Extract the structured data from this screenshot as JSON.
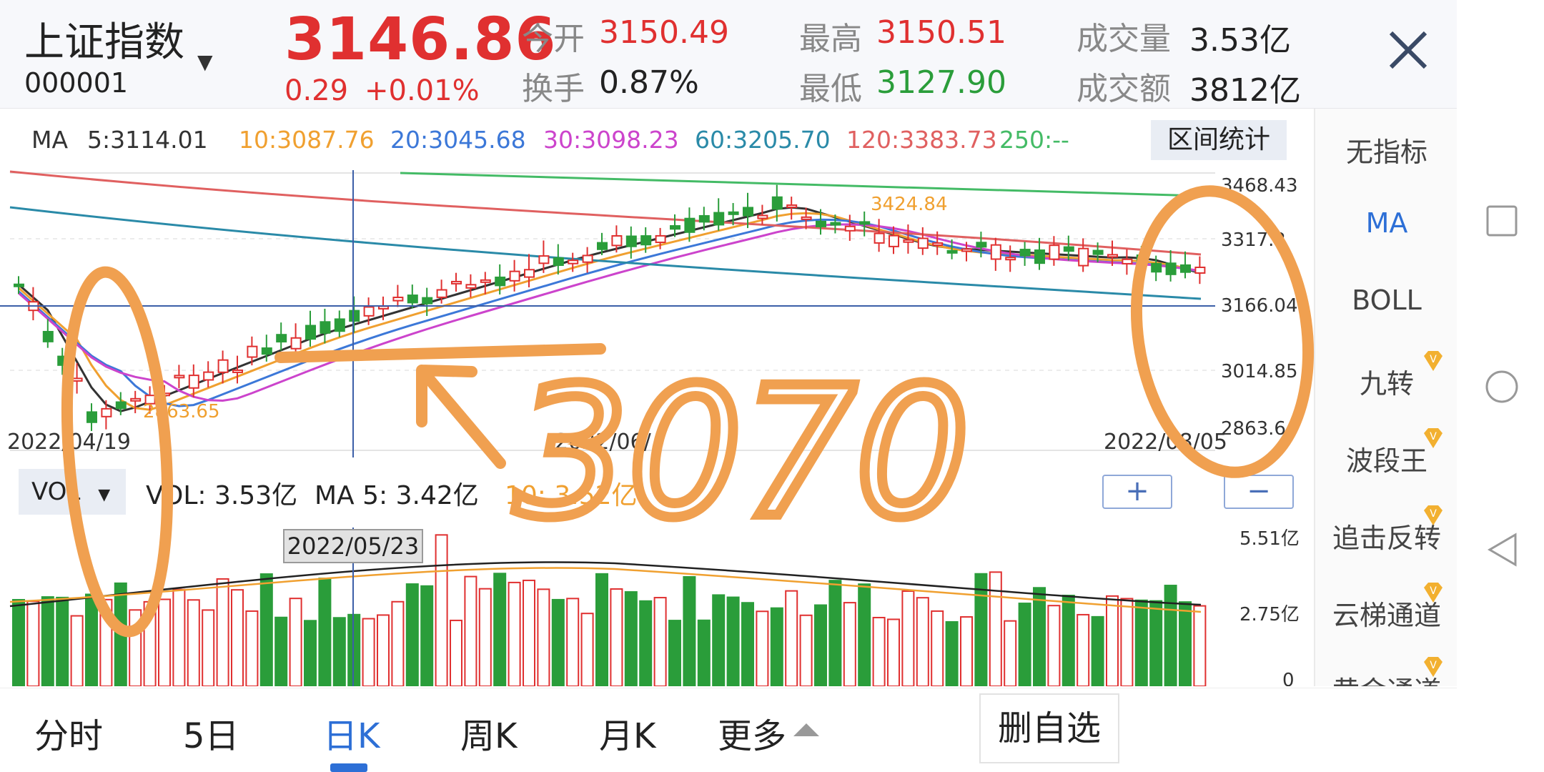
{
  "header": {
    "stock_name": "上证指数",
    "stock_code": "000001",
    "price": "3146.86",
    "change": "0.29",
    "change_pct": "+0.01%",
    "stats": {
      "open_label": "今开",
      "open_value": "3150.49",
      "turnover_label": "换手",
      "turnover_value": "0.87%",
      "high_label": "最高",
      "high_value": "3150.51",
      "low_label": "最低",
      "low_value": "3127.90",
      "volume_label": "成交量",
      "volume_value": "3.53亿",
      "amount_label": "成交额",
      "amount_value": "3812亿"
    }
  },
  "ma_legend": {
    "prefix": "MA",
    "items": [
      {
        "text": "5:3114.01",
        "color": "#333333"
      },
      {
        "text": "10:3087.76",
        "color": "#f0a030"
      },
      {
        "text": "20:3045.68",
        "color": "#3c78d8"
      },
      {
        "text": "30:3098.23",
        "color": "#cc44cc"
      },
      {
        "text": "60:3205.70",
        "color": "#2a8aa8"
      },
      {
        "text": "120:3383.73",
        "color": "#e06060"
      },
      {
        "text": "250:--",
        "color": "#44bb66"
      }
    ],
    "range_button": "区间统计"
  },
  "kchart": {
    "price_labels": [
      "3468.43",
      "3317.2",
      "3166.04",
      "3014.85",
      "2863.6"
    ],
    "date_labels": [
      "2022/04/19",
      "2022/06/",
      "2022/08/05"
    ],
    "annotations": [
      "3424.84",
      "2863.65"
    ]
  },
  "volume": {
    "selector": "VOL",
    "vol_text": "VOL: 3.53亿",
    "ma5_text": "MA 5: 3.42亿",
    "ma10_text": "10: 3.52亿",
    "zoom_in": "+",
    "zoom_out": "−",
    "axis_labels": [
      "5.51亿",
      "2.75亿",
      "0"
    ],
    "date_tooltip": "2022/05/23"
  },
  "indicators": {
    "items": [
      {
        "label": "无指标",
        "active": false,
        "vip": false
      },
      {
        "label": "MA",
        "active": true,
        "vip": false
      },
      {
        "label": "BOLL",
        "active": false,
        "vip": false
      },
      {
        "label": "九转",
        "active": false,
        "vip": true
      },
      {
        "label": "波段王",
        "active": false,
        "vip": true
      },
      {
        "label": "追击反转",
        "active": false,
        "vip": true
      },
      {
        "label": "云梯通道",
        "active": false,
        "vip": true
      },
      {
        "label": "黄金通道",
        "active": false,
        "vip": true
      }
    ],
    "vip_badge": "V"
  },
  "tabs": {
    "items": [
      {
        "label": "分时",
        "active": false
      },
      {
        "label": "5日",
        "active": false
      },
      {
        "label": "日K",
        "active": true
      },
      {
        "label": "周K",
        "active": false
      },
      {
        "label": "月K",
        "active": false
      },
      {
        "label": "更多",
        "active": false
      }
    ],
    "delete_watch": "删自选"
  },
  "handwritten_annotation": "3070",
  "colors": {
    "up": "#e03030",
    "down": "#2a9d3a",
    "accent": "#2d6fd6",
    "annotation": "#f0a050"
  },
  "icons": {
    "close": "close-icon",
    "nav_square": "square-icon",
    "nav_circle": "circle-icon",
    "nav_back": "triangle-back-icon"
  }
}
